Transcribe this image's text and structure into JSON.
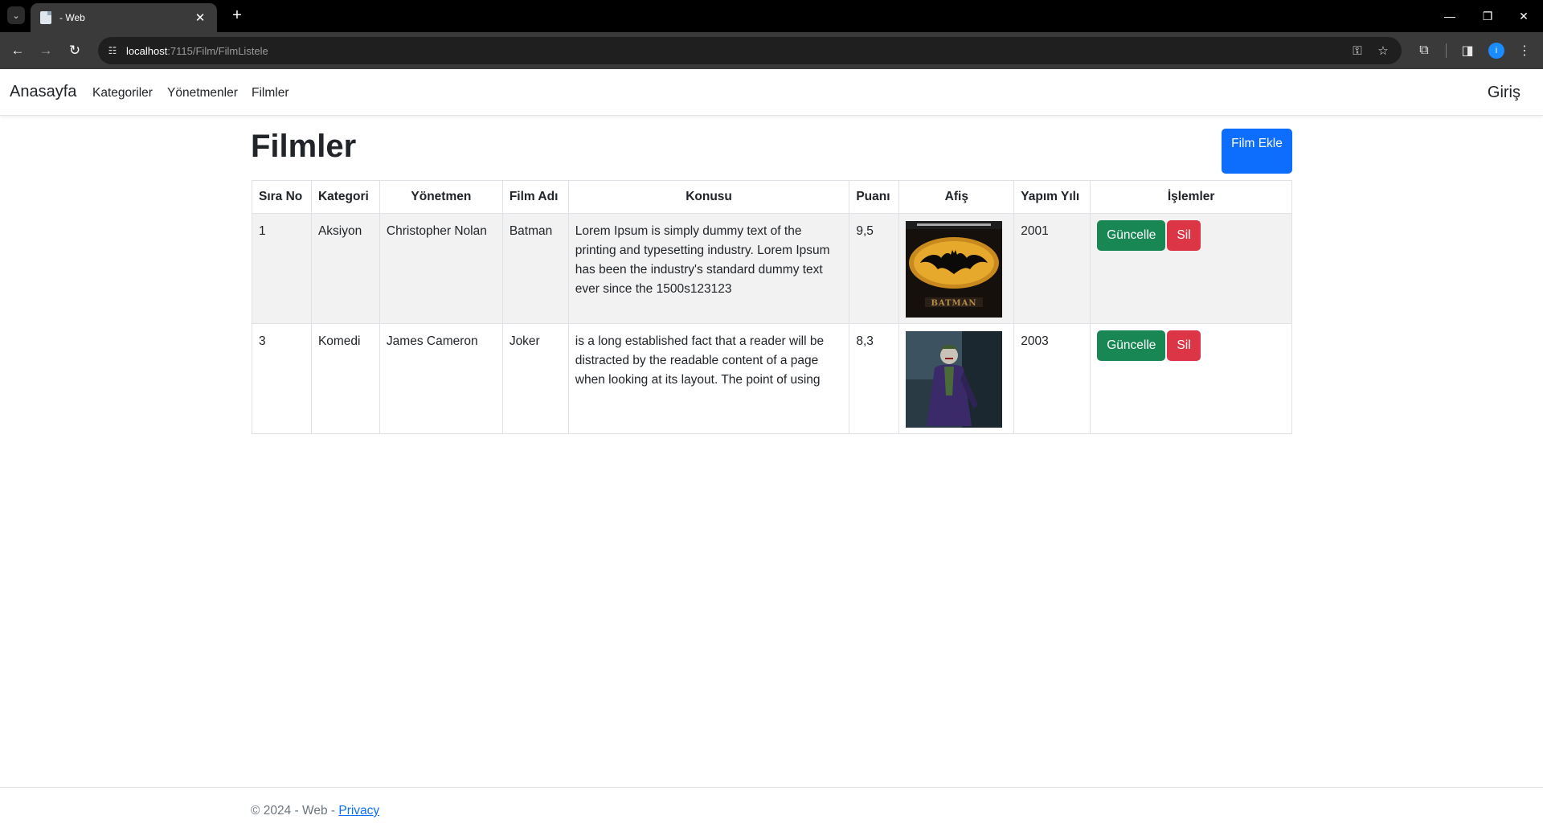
{
  "browser": {
    "tab_title": "- Web",
    "url_host": "localhost",
    "url_path": ":7115/Film/FilmListele"
  },
  "navbar": {
    "brand": "Anasayfa",
    "links": [
      "Kategoriler",
      "Yönetmenler",
      "Filmler"
    ],
    "login": "Giriş"
  },
  "page": {
    "title": "Filmler",
    "add_button": "Film Ekle"
  },
  "table": {
    "headers": [
      "Sıra No",
      "Kategori",
      "Yönetmen",
      "Film Adı",
      "Konusu",
      "Puanı",
      "Afiş",
      "Yapım Yılı",
      "İşlemler"
    ],
    "rows": [
      {
        "no": "1",
        "category": "Aksiyon",
        "director": "Christopher Nolan",
        "name": "Batman",
        "plot": "Lorem Ipsum is simply dummy text of the printing and typesetting industry. Lorem Ipsum has been the industry's standard dummy text ever since the 1500s123123",
        "rating": "9,5",
        "year": "2001",
        "poster_text": "BATMAN",
        "update": "Güncelle",
        "delete": "Sil"
      },
      {
        "no": "3",
        "category": "Komedi",
        "director": "James Cameron",
        "name": "Joker",
        "plot": "is a long established fact that a reader will be distracted by the readable content of a page when looking at its layout. The point of using",
        "rating": "8,3",
        "year": "2003",
        "update": "Güncelle",
        "delete": "Sil"
      }
    ]
  },
  "footer": {
    "text": "© 2024 - Web - ",
    "privacy": "Privacy"
  }
}
